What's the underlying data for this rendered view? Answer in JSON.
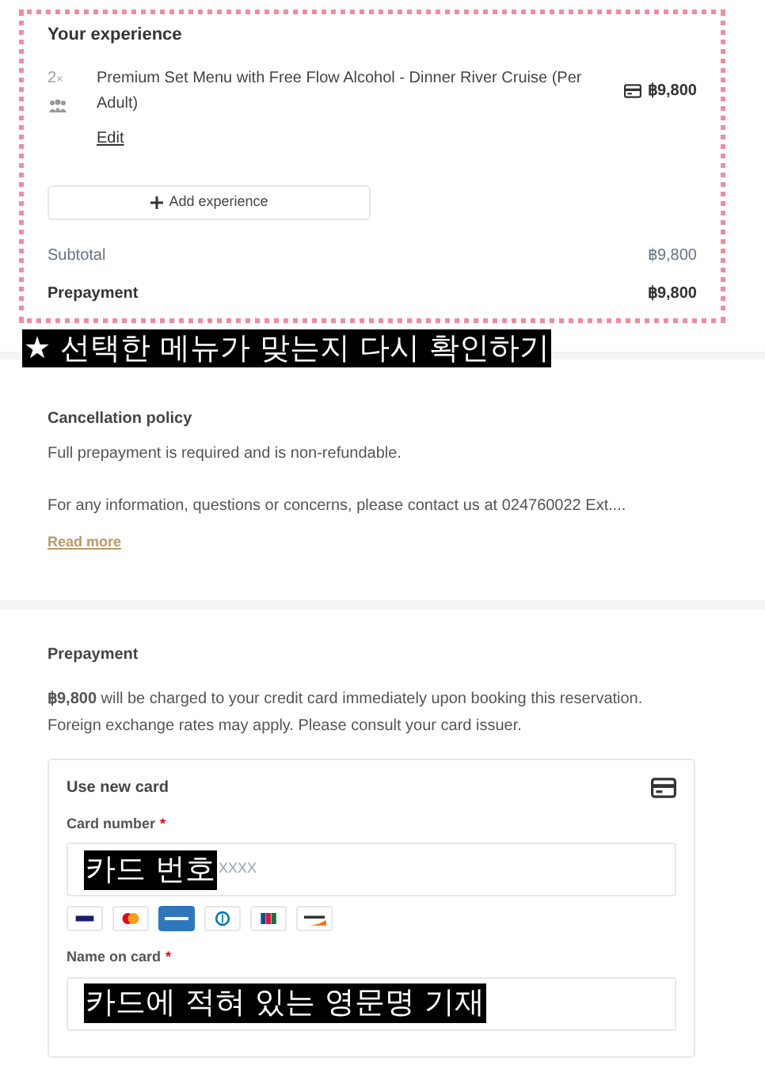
{
  "experience": {
    "title": "Your experience",
    "items": [
      {
        "quantity": "2",
        "multiplier": "×",
        "name": "Premium Set Menu with Free Flow Alcohol - Dinner River Cruise (Per Adult)",
        "edit": "Edit",
        "price": "฿9,800"
      }
    ],
    "add_button": "Add experience",
    "subtotal": {
      "label": "Subtotal",
      "value": "฿9,800"
    },
    "prepayment": {
      "label": "Prepayment",
      "value": "฿9,800"
    }
  },
  "annotation_top": "★ 선택한 메뉴가 맞는지 다시 확인하기",
  "cancellation": {
    "title": "Cancellation policy",
    "lines": [
      "Full prepayment is required and is non-refundable.",
      "For any information, questions or concerns, please contact us at 024760022 Ext...."
    ],
    "read_more": "Read more"
  },
  "prepayment": {
    "title": "Prepayment",
    "text": "**฿9,800** will be charged to your credit card immediately upon booking this reservation. Foreign exchange rates may apply. Please consult your card issuer.",
    "card": {
      "title": "Use new card",
      "fields": [
        {
          "kind": "card_number",
          "label": "Card number",
          "required_mark": "*",
          "annotation": "카드 번호",
          "placeholder": "XXXX"
        },
        {
          "kind": "name",
          "label": "Name on card",
          "required_mark": "*",
          "annotation": "카드에 적혀 있는 영문명 기재"
        }
      ]
    }
  }
}
